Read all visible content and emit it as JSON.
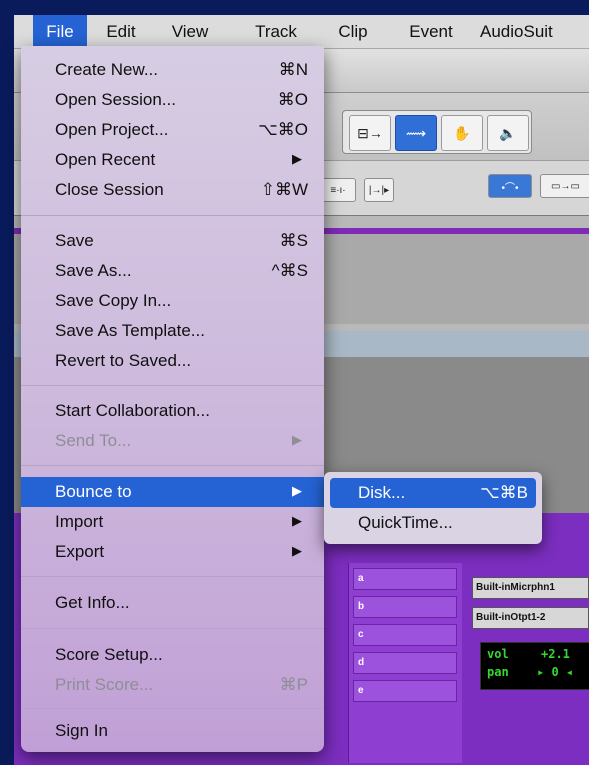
{
  "menubar": {
    "items": [
      "File",
      "Edit",
      "View",
      "Track",
      "Clip",
      "Event",
      "AudioSuit"
    ]
  },
  "file_menu": {
    "items": [
      {
        "label": "Create New...",
        "shortcut": "⌘N"
      },
      {
        "label": "Open Session...",
        "shortcut": "⌘O"
      },
      {
        "label": "Open Project...",
        "shortcut": "⌥⌘O"
      },
      {
        "label": "Open Recent",
        "shortcut": "▶"
      },
      {
        "label": "Close Session",
        "shortcut": "⇧⌘W"
      },
      {
        "label": "Save",
        "shortcut": "⌘S"
      },
      {
        "label": "Save As...",
        "shortcut": "^⌘S"
      },
      {
        "label": "Save Copy In...",
        "shortcut": ""
      },
      {
        "label": "Save As Template...",
        "shortcut": ""
      },
      {
        "label": "Revert to Saved...",
        "shortcut": ""
      },
      {
        "label": "Start Collaboration...",
        "shortcut": ""
      },
      {
        "label": "Send To...",
        "shortcut": "▶"
      },
      {
        "label": "Bounce to",
        "shortcut": "▶"
      },
      {
        "label": "Import",
        "shortcut": "▶"
      },
      {
        "label": "Export",
        "shortcut": "▶"
      },
      {
        "label": "Get Info...",
        "shortcut": ""
      },
      {
        "label": "Score Setup...",
        "shortcut": ""
      },
      {
        "label": "Print Score...",
        "shortcut": "⌘P"
      },
      {
        "label": "Sign In",
        "shortcut": ""
      }
    ]
  },
  "bounce_submenu": {
    "items": [
      {
        "label": "Disk...",
        "shortcut": "⌥⌘B"
      },
      {
        "label": "QuickTime...",
        "shortcut": ""
      }
    ]
  },
  "mixer": {
    "slots": [
      "a",
      "b",
      "c",
      "d",
      "e"
    ],
    "input": "Built-inMicrphn1",
    "output": "Built-inOtpt1-2",
    "vol_label": "vol",
    "vol_value": "+2.1",
    "pan_label": "pan",
    "pan_value": "▸ 0 ◂"
  },
  "colors": {
    "highlight": "#2563d4",
    "mixer_purple": "#7c2ec0",
    "desktop": "#0a1b5c"
  }
}
